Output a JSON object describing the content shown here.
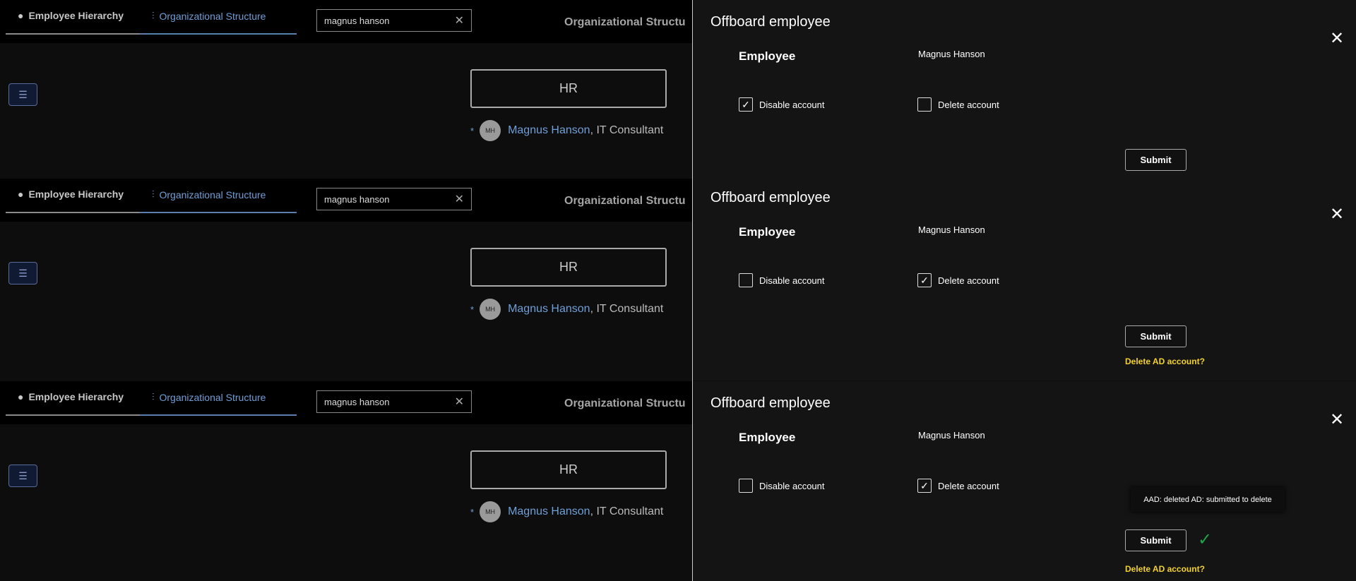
{
  "nav": {
    "tab_hierarchy": "Employee Hierarchy",
    "tab_org": "Organizational Structure",
    "search_value": "magnus hanson",
    "page_title": "Organizational Structu"
  },
  "org": {
    "unit": "HR",
    "avatar_initials": "MH",
    "person_name": "Magnus Hanson",
    "person_role": ", IT Consultant",
    "bullet": "*"
  },
  "icons": {
    "close": "✕",
    "menu": "☰",
    "check": "✓"
  },
  "dialogs": [
    {
      "title": "Offboard employee",
      "employee_label": "Employee",
      "employee_value": "Magnus Hanson",
      "disable_label": "Disable account",
      "delete_label": "Delete account",
      "disable_checked": true,
      "delete_checked": false,
      "submit": "Submit"
    },
    {
      "title": "Offboard employee",
      "employee_label": "Employee",
      "employee_value": "Magnus Hanson",
      "disable_label": "Disable account",
      "delete_label": "Delete account",
      "disable_checked": false,
      "delete_checked": true,
      "submit": "Submit",
      "warning": "Delete AD account?"
    },
    {
      "title": "Offboard employee",
      "employee_label": "Employee",
      "employee_value": "Magnus Hanson",
      "disable_label": "Disable account",
      "delete_label": "Delete account",
      "disable_checked": false,
      "delete_checked": true,
      "submit": "Submit",
      "warning": "Delete AD account?",
      "tooltip": "AAD: deleted AD: submitted to delete",
      "success": true
    }
  ],
  "colors": {
    "accent": "#6f9fd8",
    "warning": "#f3d22b",
    "success": "#1fa34a"
  }
}
